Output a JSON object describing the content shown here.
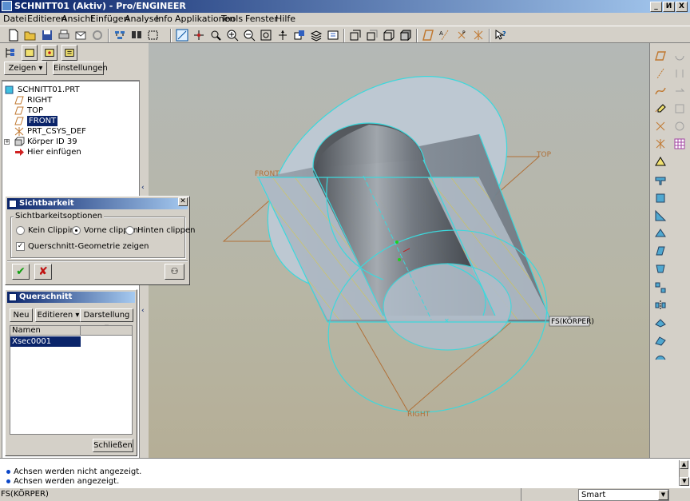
{
  "window": {
    "title": "SCHNITT01 (Aktiv) - Pro/ENGINEER",
    "controls": [
      "_",
      "И",
      "X"
    ]
  },
  "menu": [
    "Datei",
    "Editieren",
    "Ansicht",
    "Einfügen",
    "Analyse",
    "Info",
    "Applikationen",
    "Tools",
    "Fenster",
    "Hilfe"
  ],
  "toolbar": {
    "icons": [
      "new-icon",
      "open-icon",
      "save-icon",
      "print-icon",
      "email-icon",
      "unlink-icon",
      "regenerate-icon",
      "find-icon",
      "select-box-icon",
      "repaint-icon",
      "spin-center-icon",
      "orient-icon",
      "zoom-in-icon",
      "zoom-out-icon",
      "refit-icon",
      "reorient-icon",
      "saved-views-icon",
      "layers-icon",
      "view-manager-icon",
      "wireframe-icon",
      "hidden-line-icon",
      "no-hidden-icon",
      "shading-icon",
      "datum-planes-icon",
      "datum-axes-icon",
      "datum-points-icon",
      "csys-icon",
      "context-help-icon"
    ]
  },
  "left_panel": {
    "icons": [
      "tree-icon",
      "layer-icon",
      "folder-icon",
      "favorites-icon"
    ],
    "zeigen_label": "Zeigen ▾",
    "einstellungen_label": "Einstellungen ▾",
    "tree": [
      {
        "label": "SCHNITT01.PRT",
        "icon": "part-icon",
        "selected": false
      },
      {
        "label": "RIGHT",
        "icon": "datum-plane-icon",
        "selected": false
      },
      {
        "label": "TOP",
        "icon": "datum-plane-icon",
        "selected": false
      },
      {
        "label": "FRONT",
        "icon": "datum-plane-icon",
        "selected": true
      },
      {
        "label": "PRT_CSYS_DEF",
        "icon": "csys-icon",
        "selected": false
      },
      {
        "label": "Körper ID 39",
        "icon": "solid-feature-icon",
        "selected": false
      },
      {
        "label": "Hier einfügen",
        "icon": "insert-arrow-icon",
        "selected": false
      }
    ]
  },
  "sichtbarkeit_dialog": {
    "title": "Sichtbarkeit",
    "group_label": "Sichtbarkeitsoptionen",
    "radio_options": [
      "Kein Clipping",
      "Vorne clippen",
      "Hinten clippen"
    ],
    "selected_option": "Vorne clippen",
    "checkbox_label": "Querschnitt-Geometrie zeigen",
    "checkbox_checked": true
  },
  "querschnitt_dialog": {
    "title": "Querschnitt",
    "buttons": [
      "Neu",
      "Editieren ▾",
      "Darstellung ▾"
    ],
    "column_header": "Namen",
    "rows": [
      "Xsec0001"
    ],
    "close_label": "Schließen"
  },
  "viewport": {
    "labels": {
      "front": "FRONT",
      "top": "TOP",
      "right": "RIGHT",
      "section": "FS(KÖRPER)"
    },
    "colors": {
      "datum": "#c07830",
      "edge": "#3cd8dc",
      "section_fill": "#b2bdc8"
    }
  },
  "messages": [
    "Achsen werden nicht angezeigt.",
    "Achsen werden angezeigt."
  ],
  "status": {
    "left": "FS(KÖRPER)",
    "filter_value": "Smart"
  }
}
